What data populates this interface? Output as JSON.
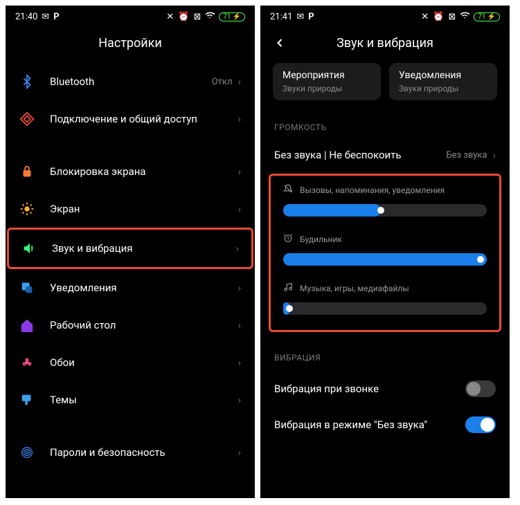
{
  "left": {
    "status": {
      "time": "21:40",
      "battery": "71"
    },
    "title": "Настройки",
    "items": [
      {
        "id": "bluetooth",
        "label": "Bluetooth",
        "value": "Откл",
        "icon": "bluetooth",
        "color": "#3a7fe8"
      },
      {
        "id": "share",
        "label": "Подключение и общий доступ",
        "icon": "share",
        "color": "#e84a3a"
      }
    ],
    "items2": [
      {
        "id": "lock",
        "label": "Блокировка экрана",
        "icon": "lock",
        "color": "#ff7a3a"
      },
      {
        "id": "screen",
        "label": "Экран",
        "icon": "sun",
        "color": "#ffb03a"
      },
      {
        "id": "sound",
        "label": "Звук и вибрация",
        "icon": "speaker",
        "color": "#3aff7a",
        "highlight": true
      },
      {
        "id": "notif",
        "label": "Уведомления",
        "icon": "notif",
        "color": "#3a9fe8"
      },
      {
        "id": "desktop",
        "label": "Рабочий стол",
        "icon": "home",
        "color": "#8a3ae8"
      },
      {
        "id": "wallpaper",
        "label": "Обои",
        "icon": "flower",
        "color": "#e83a7a"
      },
      {
        "id": "themes",
        "label": "Темы",
        "icon": "brush",
        "color": "#3a9fe8"
      }
    ],
    "items3": [
      {
        "id": "security",
        "label": "Пароли и безопасность",
        "icon": "fingerprint",
        "color": "#3a7fe8"
      }
    ]
  },
  "right": {
    "status": {
      "time": "21:41",
      "battery": "71"
    },
    "title": "Звук и вибрация",
    "chips": [
      {
        "title": "Мероприятия",
        "sub": "Звуки природы"
      },
      {
        "title": "Уведомления",
        "sub": "Звуки природы"
      }
    ],
    "volumeSection": "ГРОМКОСТЬ",
    "silentRow": {
      "label": "Без звука | Не беспокоить",
      "value": "Без звука"
    },
    "sliders": [
      {
        "label": "Вызовы, напоминания, уведомления",
        "icon": "bell-off",
        "pct": 48
      },
      {
        "label": "Будильник",
        "icon": "alarm",
        "pct": 100
      },
      {
        "label": "Музыка, игры, медиафайлы",
        "icon": "music",
        "pct": 3
      }
    ],
    "vibrationSection": "ВИБРАЦИЯ",
    "toggles": [
      {
        "label": "Вибрация при звонке",
        "on": false
      },
      {
        "label": "Вибрация в режиме \"Без звука\"",
        "on": true
      }
    ]
  }
}
